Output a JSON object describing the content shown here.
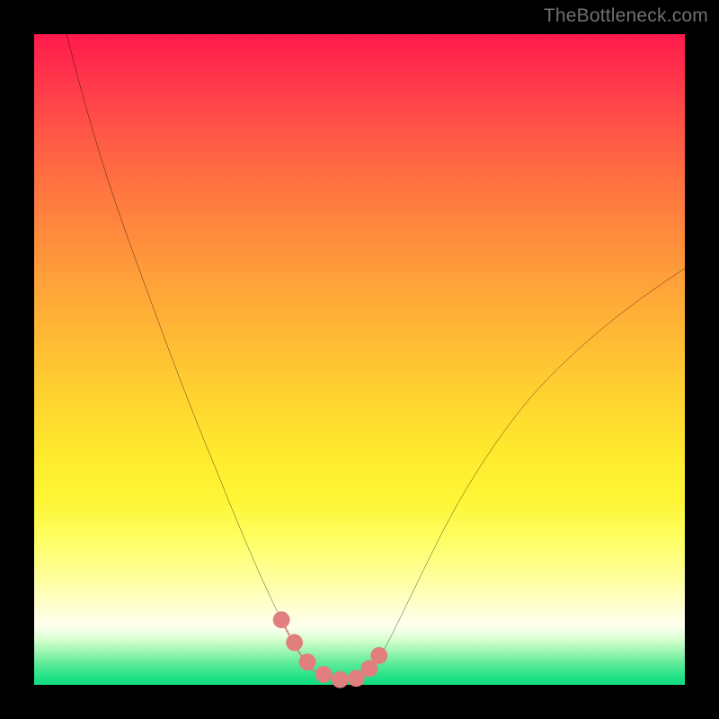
{
  "watermark": "TheBottleneck.com",
  "chart_data": {
    "type": "line",
    "title": "",
    "xlabel": "",
    "ylabel": "",
    "xlim": [
      0,
      100
    ],
    "ylim": [
      0,
      100
    ],
    "grid": false,
    "background": "heat-gradient-red-to-green",
    "series": [
      {
        "name": "bottleneck-curve",
        "color": "#000000",
        "x": [
          5,
          10,
          15,
          20,
          25,
          30,
          35,
          38,
          40,
          42,
          44,
          46,
          48,
          50,
          52,
          55,
          60,
          65,
          70,
          75,
          80,
          85,
          90,
          95,
          100
        ],
        "y": [
          100,
          90,
          77,
          63,
          49,
          35,
          21,
          12,
          7,
          4,
          2,
          1,
          1,
          1,
          2,
          5,
          13,
          22,
          31,
          39,
          45,
          51,
          56,
          60,
          64
        ]
      },
      {
        "name": "valley-markers",
        "color": "#e27c7c",
        "type": "scatter",
        "x": [
          38,
          40,
          42,
          44,
          46,
          48,
          50,
          52
        ],
        "y": [
          12,
          6,
          3,
          1,
          1,
          1,
          2,
          5
        ]
      }
    ]
  }
}
